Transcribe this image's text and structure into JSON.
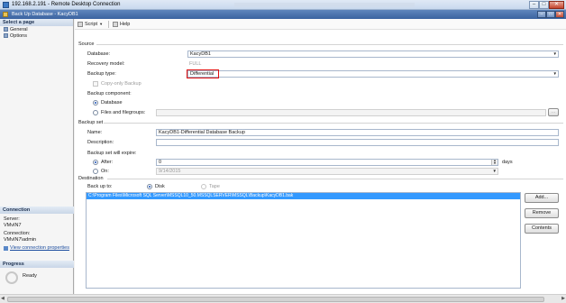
{
  "rdp_window": {
    "title": "192.168.2.191 - Remote Desktop Connection",
    "buttons": {
      "minimize": "–",
      "maximize": "□",
      "close": "✕"
    }
  },
  "dialog": {
    "title": "Back Up Database - KacyDB1",
    "buttons": {
      "minimize": "–",
      "maximize": "□",
      "close": "✕"
    }
  },
  "left_panel": {
    "select_page_header": "Select a page",
    "pages": [
      {
        "label": "General",
        "icon": "page-icon"
      },
      {
        "label": "Options",
        "icon": "page-icon"
      }
    ],
    "connection_header": "Connection",
    "server_label": "Server:",
    "server_value": "VMvIN7",
    "connection_label": "Connection:",
    "connection_value": "VMvIN7\\admin",
    "view_properties_link": "View connection properties",
    "progress_header": "Progress",
    "progress_status": "Ready"
  },
  "toolbar": {
    "script_label": "Script",
    "help_label": "Help"
  },
  "source": {
    "section_label": "Source",
    "database_label": "Database:",
    "database_value": "KacyDB1",
    "recovery_model_label": "Recovery model:",
    "recovery_model_value": "FULL",
    "backup_type_label": "Backup type:",
    "backup_type_value": "Differential",
    "copy_only_label": "Copy-only Backup",
    "copy_only_checked": false,
    "backup_component_label": "Backup component:",
    "component_database_label": "Database",
    "component_files_label": "Files and filegroups:",
    "files_browse_label": "...",
    "selected_component": "Database"
  },
  "backup_set": {
    "section_label": "Backup set",
    "name_label": "Name:",
    "name_value": "KacyDB1-Differential Database Backup",
    "description_label": "Description:",
    "description_value": "",
    "expire_label": "Backup set will expire:",
    "after_label": "After:",
    "after_value": "0",
    "days_label": "days",
    "on_label": "On:",
    "on_value": "9/14/2015",
    "selected_expire": "After"
  },
  "destination": {
    "section_label": "Destination",
    "backup_to_label": "Back up to:",
    "disk_label": "Disk",
    "tape_label": "Tape",
    "selected_media": "Disk",
    "paths": [
      "C:\\Program Files\\Microsoft SQL Server\\MSSQL10_50.MSSQLSERVER\\MSSQL\\Backup\\KacyDB1.bak"
    ],
    "add_label": "Add...",
    "remove_label": "Remove",
    "contents_label": "Contents"
  },
  "colors": {
    "highlight": "#3399ff",
    "annotation_box": "#e01010",
    "dialog_title": "#3b63a0"
  }
}
